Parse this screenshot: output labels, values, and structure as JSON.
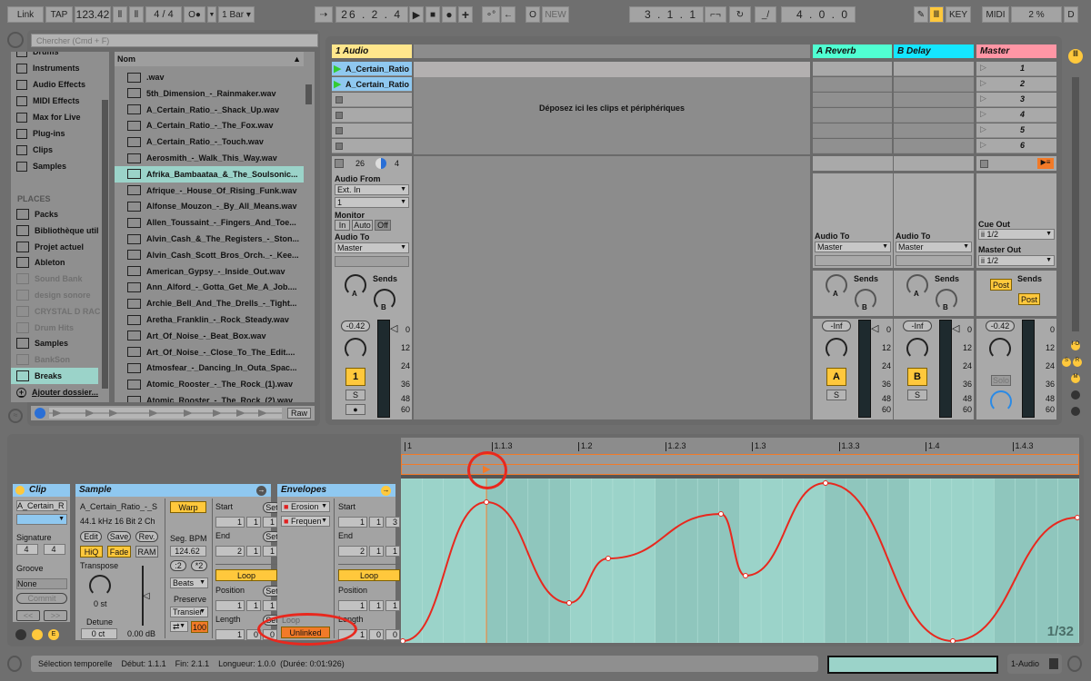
{
  "transport": {
    "link": "Link",
    "tap": "TAP",
    "tempo": "123.42",
    "signature": "4 / 4",
    "metronome": "O●",
    "quantize": "1 Bar",
    "position": "26 .  2 .  4",
    "new": "NEW",
    "loop_start": "3 .  1 .  1",
    "loop_length": "4 .  0 .  0",
    "key": "KEY",
    "midi": "MIDI",
    "cpu": "2 %",
    "disk": "D"
  },
  "browser": {
    "search_placeholder": "Chercher (Cmd + F)",
    "categories": [
      {
        "label": "Drums",
        "icon": "drums-icon"
      },
      {
        "label": "Instruments",
        "icon": "instruments-icon"
      },
      {
        "label": "Audio Effects",
        "icon": "audio-effects-icon"
      },
      {
        "label": "MIDI Effects",
        "icon": "midi-effects-icon"
      },
      {
        "label": "Max for Live",
        "icon": "max-icon"
      },
      {
        "label": "Plug-ins",
        "icon": "plugin-icon"
      },
      {
        "label": "Clips",
        "icon": "clips-icon"
      },
      {
        "label": "Samples",
        "icon": "samples-icon"
      }
    ],
    "places_title": "PLACES",
    "places": [
      {
        "label": "Packs",
        "dim": false
      },
      {
        "label": "Bibliothèque util",
        "dim": false
      },
      {
        "label": "Projet actuel",
        "dim": false
      },
      {
        "label": "Ableton",
        "dim": false
      },
      {
        "label": "Sound Bank",
        "dim": true
      },
      {
        "label": "design sonore",
        "dim": true
      },
      {
        "label": "CRYSTAL D RAC",
        "dim": true
      },
      {
        "label": "Drum Hits",
        "dim": true
      },
      {
        "label": "Samples",
        "dim": false
      },
      {
        "label": "BankSon",
        "dim": true
      },
      {
        "label": "Breaks",
        "dim": false,
        "selected": true
      }
    ],
    "add_folder": "Ajouter dossier...",
    "column_header": "Nom",
    "files": [
      ".wav",
      "5th_Dimension_-_Rainmaker.wav",
      "A_Certain_Ratio_-_Shack_Up.wav",
      "A_Certain_Ratio_-_The_Fox.wav",
      "A_Certain_Ratio_-_Touch.wav",
      "Aerosmith_-_Walk_This_Way.wav",
      "Afrika_Bambaataa_&_The_Soulsonic...",
      "Afrique_-_House_Of_Rising_Funk.wav",
      "Alfonse_Mouzon_-_By_All_Means.wav",
      "Allen_Toussaint_-_Fingers_And_Toe...",
      "Alvin_Cash_&_The_Registers_-_Ston...",
      "Alvin_Cash_Scott_Bros_Orch._-_Kee...",
      "American_Gypsy_-_Inside_Out.wav",
      "Ann_Alford_-_Gotta_Get_Me_A_Job....",
      "Archie_Bell_And_The_Drells_-_Tight...",
      "Aretha_Franklin_-_Rock_Steady.wav",
      "Art_Of_Noise_-_Beat_Box.wav",
      "Art_Of_Noise_-_Close_To_The_Edit....",
      "Atmosfear_-_Dancing_In_Outa_Spac...",
      "Atomic_Rooster_-_The_Rock_(1).wav",
      "Atomic_Rooster_-_The_Rock_(2).wav"
    ],
    "selected_file": 6,
    "raw": "Raw"
  },
  "session": {
    "drop_text": "Déposez ici les clips et périphériques",
    "track": {
      "name": "1 Audio",
      "color": "#ffe68c",
      "clips": [
        "A_Certain_Ratio",
        "A_Certain_Ratio"
      ],
      "input_num": "26",
      "input_ch": "4",
      "audio_from": "Audio From",
      "from_value": "Ext. In",
      "from_channel": "1",
      "monitor": "Monitor",
      "mon_in": "In",
      "mon_auto": "Auto",
      "mon_off": "Off",
      "audio_to": "Audio To",
      "to_value": "Master",
      "sends": "Sends",
      "volume": "-0.42",
      "number": "1",
      "solo": "S"
    },
    "returns": [
      {
        "name": "A Reverb",
        "color": "#50ffd2",
        "audio_to": "Audio To",
        "to_value": "Master",
        "sends": "Sends",
        "volume": "-Inf",
        "letter": "A",
        "solo": "S"
      },
      {
        "name": "B Delay",
        "color": "#14e6ff",
        "audio_to": "Audio To",
        "to_value": "Master",
        "sends": "Sends",
        "volume": "-Inf",
        "letter": "B",
        "solo": "S"
      }
    ],
    "master": {
      "name": "Master",
      "color": "#ff96a5",
      "scenes": [
        "1",
        "2",
        "3",
        "4",
        "5",
        "6"
      ],
      "cue_out": "Cue Out",
      "cue_value": "ii 1/2",
      "master_out": "Master Out",
      "master_value": "ii 1/2",
      "sends": "Sends",
      "post1": "Post",
      "post2": "Post",
      "volume": "-0.42",
      "solo": "Solo"
    },
    "meter_scale": [
      "0",
      "12",
      "24",
      "36",
      "48",
      "60"
    ],
    "knob_a": "A",
    "knob_b": "B"
  },
  "clip": {
    "title": "Clip",
    "name": "A_Certain_R",
    "signature": "Signature",
    "sig_num": "4",
    "sig_den": "4",
    "groove": "Groove",
    "groove_value": "None",
    "commit": "Commit",
    "prev": "<<",
    "next": ">>"
  },
  "sample": {
    "title": "Sample",
    "name": "A_Certain_Ratio_-_S",
    "format": "44.1 kHz 16 Bit 2 Ch",
    "edit": "Edit",
    "save": "Save",
    "rev": "Rev.",
    "hiq": "HiQ",
    "fade": "Fade",
    "ram": "RAM",
    "transpose": "Transpose",
    "transpose_value": "0 st",
    "detune": "Detune",
    "detune_value": "0 ct",
    "gain": "0.00 dB",
    "warp": "Warp",
    "seg_bpm": "Seg. BPM",
    "bpm": "124.62",
    "half": ":2",
    "double": "*2",
    "warp_mode": "Beats",
    "preserve": "Preserve",
    "preserve_value": "Transier",
    "percent": "100",
    "start": "Start",
    "set": "Set",
    "start_val": [
      "1",
      "1",
      "1"
    ],
    "end": "End",
    "end_val": [
      "2",
      "1",
      "1"
    ],
    "loop": "Loop",
    "position": "Position",
    "pos_val": [
      "1",
      "1",
      "1"
    ],
    "length": "Length",
    "len_val": [
      "1",
      "0",
      "0"
    ]
  },
  "envelopes": {
    "title": "Envelopes",
    "env1": "Erosion",
    "env2": "Frequen",
    "loop_label": "Loop",
    "unlinked": "Unlinked",
    "start": "Start",
    "start_val": [
      "1",
      "1",
      "3"
    ],
    "end": "End",
    "end_val": [
      "2",
      "1",
      "1"
    ],
    "loop": "Loop",
    "position": "Position",
    "pos_val": [
      "1",
      "1",
      "1"
    ],
    "length": "Length",
    "len_val": [
      "1",
      "0",
      "0"
    ]
  },
  "editor": {
    "ruler": [
      "1",
      "1.1.3",
      "1.2",
      "1.2.3",
      "1.3",
      "1.3.3",
      "1.4",
      "1.4.3"
    ],
    "zoom": "1/32",
    "envelope_color": "#e8281e",
    "bg": "#9bd3c9"
  },
  "status": {
    "text": "Sélection temporelle    Début: 1.1.1    Fin: 2.1.1    Longueur: 1.0.0  (Durée: 0:01:926)",
    "track": "1-Audio"
  }
}
